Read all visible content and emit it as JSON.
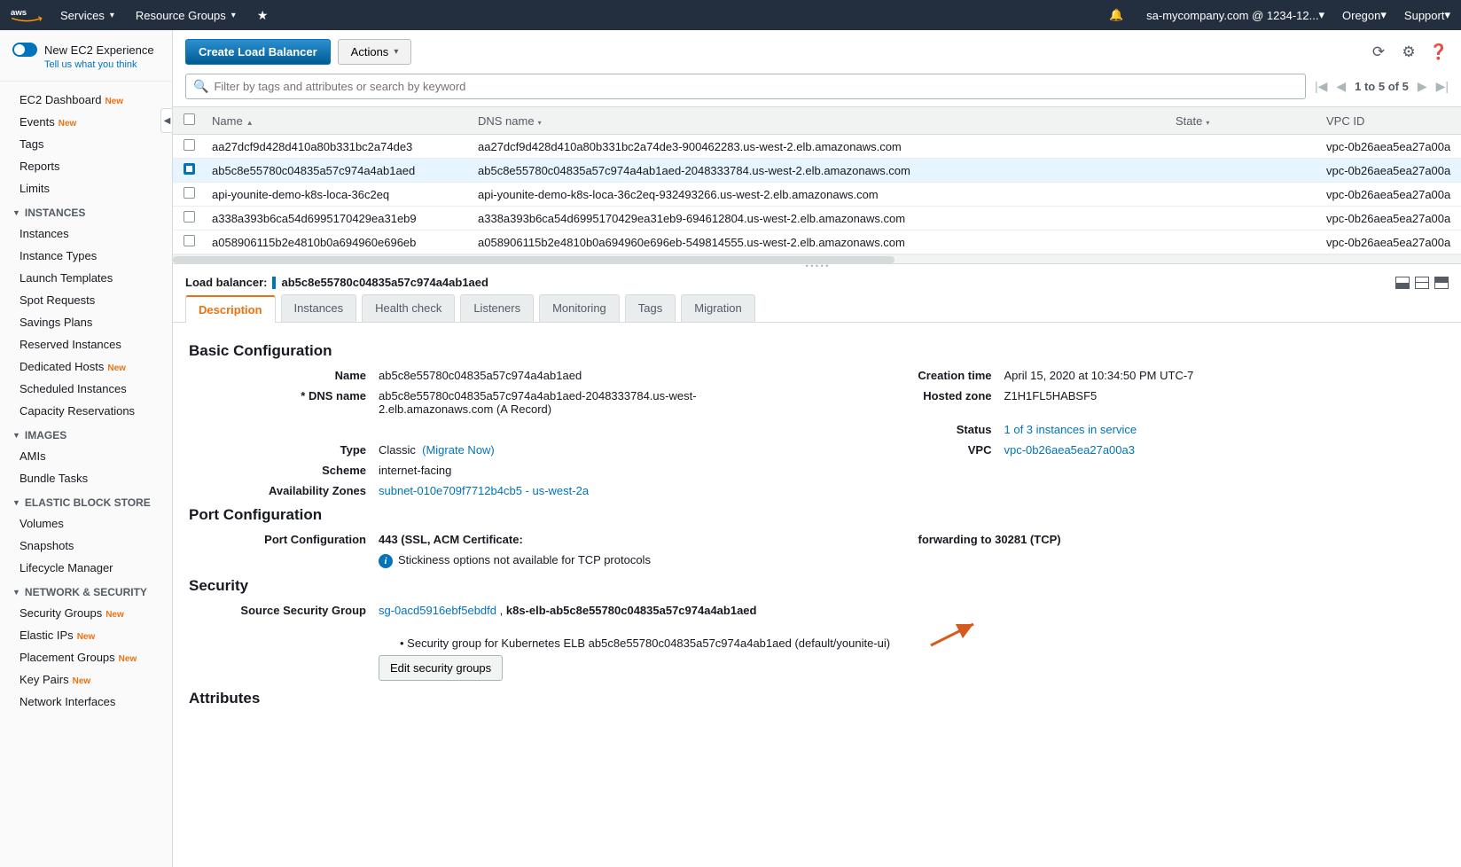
{
  "topbar": {
    "services": "Services",
    "resource_groups": "Resource Groups",
    "account": "sa-mycompany.com @ 1234-12...",
    "region": "Oregon",
    "support": "Support"
  },
  "sidebar": {
    "new_experience": "New EC2 Experience",
    "feedback": "Tell us what you think",
    "top": [
      "EC2 Dashboard",
      "Events",
      "Tags",
      "Reports",
      "Limits"
    ],
    "top_new": [
      true,
      true,
      false,
      false,
      false
    ],
    "heads": {
      "instances": "INSTANCES",
      "images": "IMAGES",
      "ebs": "ELASTIC BLOCK STORE",
      "netsec": "NETWORK & SECURITY"
    },
    "instances": [
      "Instances",
      "Instance Types",
      "Launch Templates",
      "Spot Requests",
      "Savings Plans",
      "Reserved Instances",
      "Dedicated Hosts",
      "Scheduled Instances",
      "Capacity Reservations"
    ],
    "instances_new": [
      false,
      false,
      false,
      false,
      false,
      false,
      true,
      false,
      false
    ],
    "images": [
      "AMIs",
      "Bundle Tasks"
    ],
    "ebs": [
      "Volumes",
      "Snapshots",
      "Lifecycle Manager"
    ],
    "netsec": [
      "Security Groups",
      "Elastic IPs",
      "Placement Groups",
      "Key Pairs",
      "Network Interfaces"
    ],
    "netsec_new": [
      true,
      true,
      true,
      true,
      false
    ]
  },
  "actions": {
    "create": "Create Load Balancer",
    "actions_btn": "Actions"
  },
  "filter": {
    "placeholder": "Filter by tags and attributes or search by keyword"
  },
  "pager": {
    "text": "1 to 5 of 5"
  },
  "table": {
    "cols": [
      "Name",
      "DNS name",
      "State",
      "VPC ID"
    ],
    "rows": [
      {
        "selected": false,
        "name": "aa27dcf9d428d410a80b331bc2a74de3",
        "dns": "aa27dcf9d428d410a80b331bc2a74de3-900462283.us-west-2.elb.amazonaws.com",
        "vpc": "vpc-0b26aea5ea27a00a"
      },
      {
        "selected": true,
        "name": "ab5c8e55780c04835a57c974a4ab1aed",
        "dns": "ab5c8e55780c04835a57c974a4ab1aed-2048333784.us-west-2.elb.amazonaws.com",
        "vpc": "vpc-0b26aea5ea27a00a"
      },
      {
        "selected": false,
        "name": "api-younite-demo-k8s-loca-36c2eq",
        "dns": "api-younite-demo-k8s-loca-36c2eq-932493266.us-west-2.elb.amazonaws.com",
        "vpc": "vpc-0b26aea5ea27a00a"
      },
      {
        "selected": false,
        "name": "a338a393b6ca54d6995170429ea31eb9",
        "dns": "a338a393b6ca54d6995170429ea31eb9-694612804.us-west-2.elb.amazonaws.com",
        "vpc": "vpc-0b26aea5ea27a00a"
      },
      {
        "selected": false,
        "name": "a058906115b2e4810b0a694960e696eb",
        "dns": "a058906115b2e4810b0a694960e696eb-549814555.us-west-2.elb.amazonaws.com",
        "vpc": "vpc-0b26aea5ea27a00a"
      }
    ]
  },
  "detail": {
    "prefix": "Load balancer:",
    "name": "ab5c8e55780c04835a57c974a4ab1aed",
    "tabs": [
      "Description",
      "Instances",
      "Health check",
      "Listeners",
      "Monitoring",
      "Tags",
      "Migration"
    ],
    "sections": {
      "basic_title": "Basic Configuration",
      "port_title": "Port Configuration",
      "security_title": "Security",
      "attributes_title": "Attributes"
    },
    "basic": {
      "name_label": "Name",
      "name_value": "ab5c8e55780c04835a57c974a4ab1aed",
      "dns_label": "* DNS name",
      "dns_value": "ab5c8e55780c04835a57c974a4ab1aed-2048333784.us-west-2.elb.amazonaws.com (A Record)",
      "type_label": "Type",
      "type_value": "Classic",
      "type_link": "(Migrate Now)",
      "scheme_label": "Scheme",
      "scheme_value": "internet-facing",
      "az_label": "Availability Zones",
      "az_link": "subnet-010e709f7712b4cb5 - us-west-2a",
      "creation_label": "Creation time",
      "creation_value": "April 15, 2020 at 10:34:50 PM UTC-7",
      "hosted_label": "Hosted zone",
      "hosted_value": "Z1H1FL5HABSF5",
      "status_label": "Status",
      "status_link": "1 of 3 instances in service",
      "vpc_label": "VPC",
      "vpc_link": "vpc-0b26aea5ea27a00a3"
    },
    "port": {
      "label": "Port Configuration",
      "value": "443 (SSL, ACM Certificate:",
      "fwd": "forwarding to 30281 (TCP)",
      "stick": "Stickiness options not available for TCP protocols"
    },
    "security": {
      "label": "Source Security Group",
      "sg_link": "sg-0acd5916ebf5ebdfd",
      "sep": " , ",
      "sg_rest": "k8s-elb-ab5c8e55780c04835a57c974a4ab1aed",
      "bullet": "• Security group for Kubernetes ELB ab5c8e55780c04835a57c974a4ab1aed (default/younite-ui)",
      "edit_btn": "Edit security groups"
    }
  },
  "new_label": "New"
}
